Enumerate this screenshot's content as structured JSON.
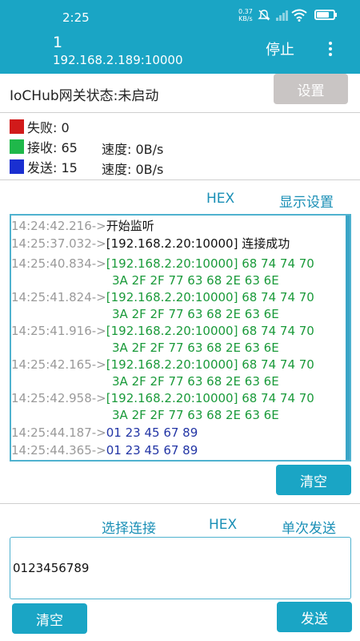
{
  "status_bar": {
    "time": "2:25",
    "net_speed_value": "0.37",
    "net_speed_unit": "KB/s"
  },
  "appbar": {
    "title": "1",
    "subtitle": "192.168.2.189:10000",
    "stop_label": "停止",
    "color": "#1aa5c5"
  },
  "gateway": {
    "status_text": "IoCHub网关状态:未启动",
    "settings_label": "设置"
  },
  "stats": {
    "fail_label": "失败: 0",
    "recv_label": "接收: 65",
    "send_label": "发送: 15",
    "recv_speed": "速度: 0B/s",
    "send_speed": "速度: 0B/s",
    "colors": {
      "fail": "#d11a1a",
      "recv": "#1fb84a",
      "send": "#1a2fd1"
    }
  },
  "log_toolbar": {
    "hex_label": "HEX",
    "display_settings_label": "显示设置"
  },
  "log": [
    {
      "time": "14:24:42.216->",
      "text": "开始监听",
      "cont": "",
      "color": "black"
    },
    {
      "time": "14:25:37.032->",
      "text": "[192.168.2.20:10000] 连接成功",
      "cont": "",
      "color": "black"
    },
    {
      "time": "14:25:40.834->",
      "text": "[192.168.2.20:10000] 68 74 74 70",
      "cont": "3A 2F 2F 77 63 68 2E 63 6E",
      "color": "green"
    },
    {
      "time": "14:25:41.824->",
      "text": "[192.168.2.20:10000] 68 74 74 70",
      "cont": "3A 2F 2F 77 63 68 2E 63 6E",
      "color": "green"
    },
    {
      "time": "14:25:41.916->",
      "text": "[192.168.2.20:10000] 68 74 74 70",
      "cont": "3A 2F 2F 77 63 68 2E 63 6E",
      "color": "green"
    },
    {
      "time": "14:25:42.165->",
      "text": "[192.168.2.20:10000] 68 74 74 70",
      "cont": "3A 2F 2F 77 63 68 2E 63 6E",
      "color": "green"
    },
    {
      "time": "14:25:42.958->",
      "text": "[192.168.2.20:10000] 68 74 74 70",
      "cont": "3A 2F 2F 77 63 68 2E 63 6E",
      "color": "green"
    },
    {
      "time": "14:25:44.187->",
      "text": "01 23 45 67 89",
      "cont": "",
      "color": "blue"
    },
    {
      "time": "14:25:44.365->",
      "text": "01 23 45 67 89",
      "cont": "",
      "color": "blue"
    }
  ],
  "log_clear_label": "清空",
  "send_toolbar": {
    "select_connection_label": "选择连接",
    "hex_label": "HEX",
    "single_send_label": "单次发送"
  },
  "send_input": {
    "value": "0123456789"
  },
  "bottom": {
    "clear_label": "清空",
    "send_label": "发送"
  }
}
